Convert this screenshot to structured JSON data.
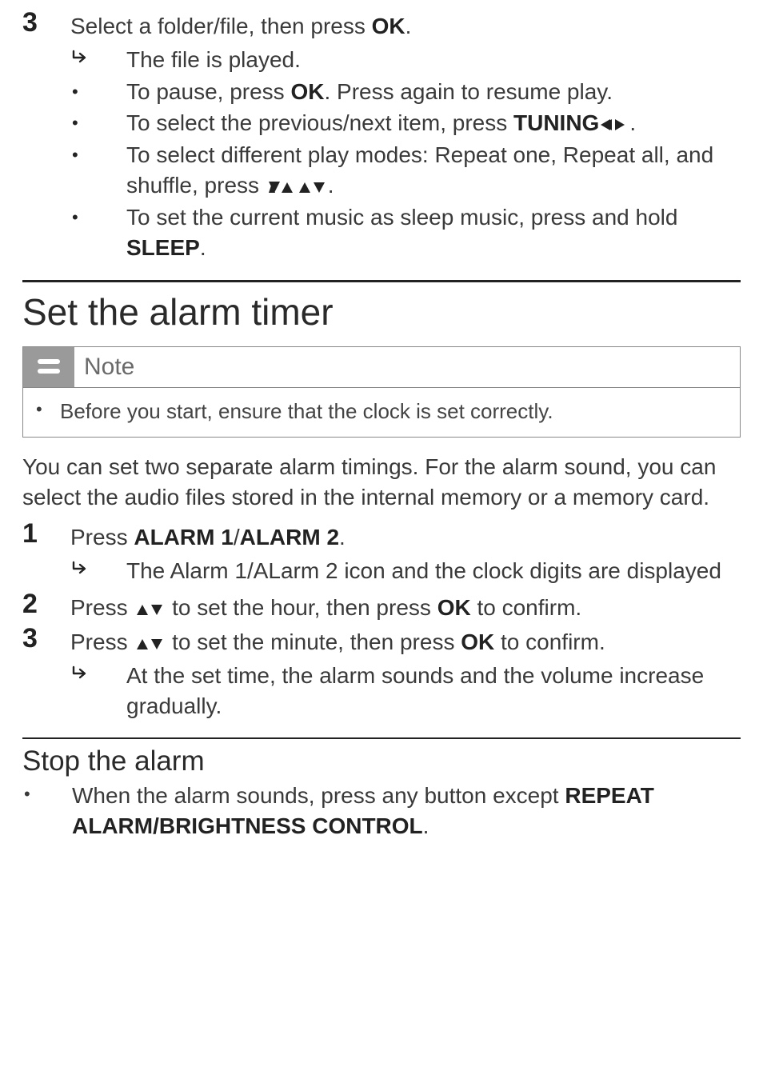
{
  "glyphs": {
    "result_arrow": "↪",
    "bullet": "•"
  },
  "step3": {
    "number": "3",
    "text_before": "Select a folder/file, then press ",
    "text_bold": "OK",
    "text_after": ".",
    "result": "The file is played.",
    "bullets": [
      {
        "pre": "To pause, press ",
        "b1": "OK",
        "mid": ". Press again to resume play."
      },
      {
        "pre": "To select the previous/next item, press ",
        "b1": "TUNING",
        "glyph": "lr",
        "post": "."
      },
      {
        "pre": "To select different play modes: Repeat one, Repeat all, and shuffle, press ",
        "glyph": "ud",
        "post": "."
      },
      {
        "pre": "To set the current music as sleep music, press and hold ",
        "b1": "SLEEP",
        "post": "."
      }
    ]
  },
  "alarm_section": {
    "title": "Set the alarm timer",
    "note_label": "Note",
    "note_text": "Before you start, ensure that the clock is set correctly.",
    "intro": "You can set two separate alarm timings. For the alarm sound, you can select the audio files stored in the internal memory or a memory card.",
    "steps": [
      {
        "num": "1",
        "pre": "Press ",
        "b1": "ALARM 1",
        "sep": "/",
        "b2": "ALARM 2",
        "post": ".",
        "result": "The Alarm 1/ALarm 2 icon and the clock digits are displayed"
      },
      {
        "num": "2",
        "pre": "Press ",
        "glyph": "ud",
        "mid": " to set the hour, then press ",
        "b1": "OK",
        "post": " to confirm."
      },
      {
        "num": "3",
        "pre": "Press ",
        "glyph": "ud",
        "mid": " to set the minute, then press ",
        "b1": "OK",
        "post": " to confirm.",
        "result": "At the set time, the alarm sounds and the volume increase gradually."
      }
    ],
    "stop": {
      "title": "Stop the alarm",
      "bullet_pre": "When the alarm sounds, press any button except ",
      "bullet_bold": "REPEAT ALARM/BRIGHTNESS CONTROL",
      "bullet_post": "."
    }
  }
}
